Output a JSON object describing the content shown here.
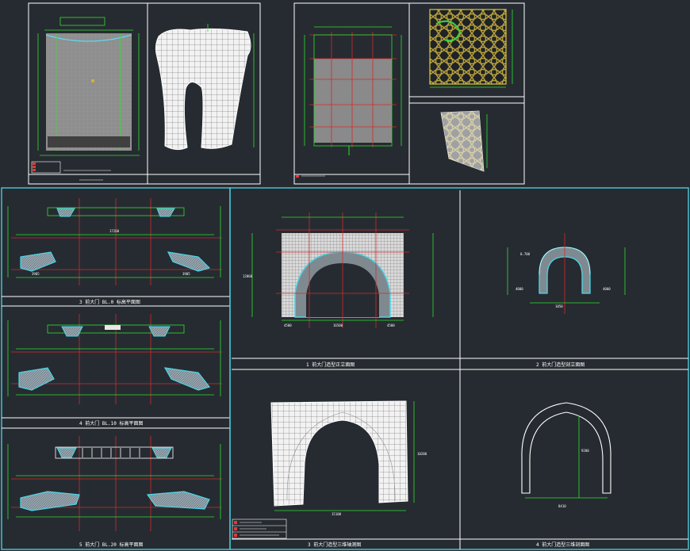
{
  "drawing": {
    "background": "#262b31",
    "line_colors": {
      "frame": "#ffffff",
      "dimension": "#2fe02f",
      "axis": "#d42b2b",
      "highlight": "#4ad6e8",
      "fill_gray": "#8a8a8a",
      "lattice": "#b8a03a"
    }
  },
  "captions": {
    "plan_1": "3 前大门 BL.0 标高平面图",
    "plan_2": "4 前大门 BL.10 标高平面图",
    "plan_3": "5 前大门 BL.20 标高平面图",
    "front_elevation": "1 前大门造型正立面图",
    "section": "2 前大门造型剖立面图",
    "axon_front": "3 前大门造型三维轴测图",
    "axon_section": "4 前大门造型三维剖面图"
  },
  "dimensions": {
    "plan_width": "17260",
    "plan_seg_left": "3905",
    "plan_seg_right": "3905",
    "elev_height": "12060",
    "elev_width": "16500",
    "elev_left": "4500",
    "elev_right": "4500",
    "section_width": "1050",
    "section_h_left": "4000",
    "section_h_right": "4000",
    "section_top": "0.700",
    "axon_height": "10200",
    "axon_width": "15100",
    "arch_height": "9200",
    "arch_width": "8410"
  },
  "legend": {
    "left_rows": [
      "",
      "",
      ""
    ],
    "right_rows": [
      "",
      "",
      ""
    ]
  }
}
